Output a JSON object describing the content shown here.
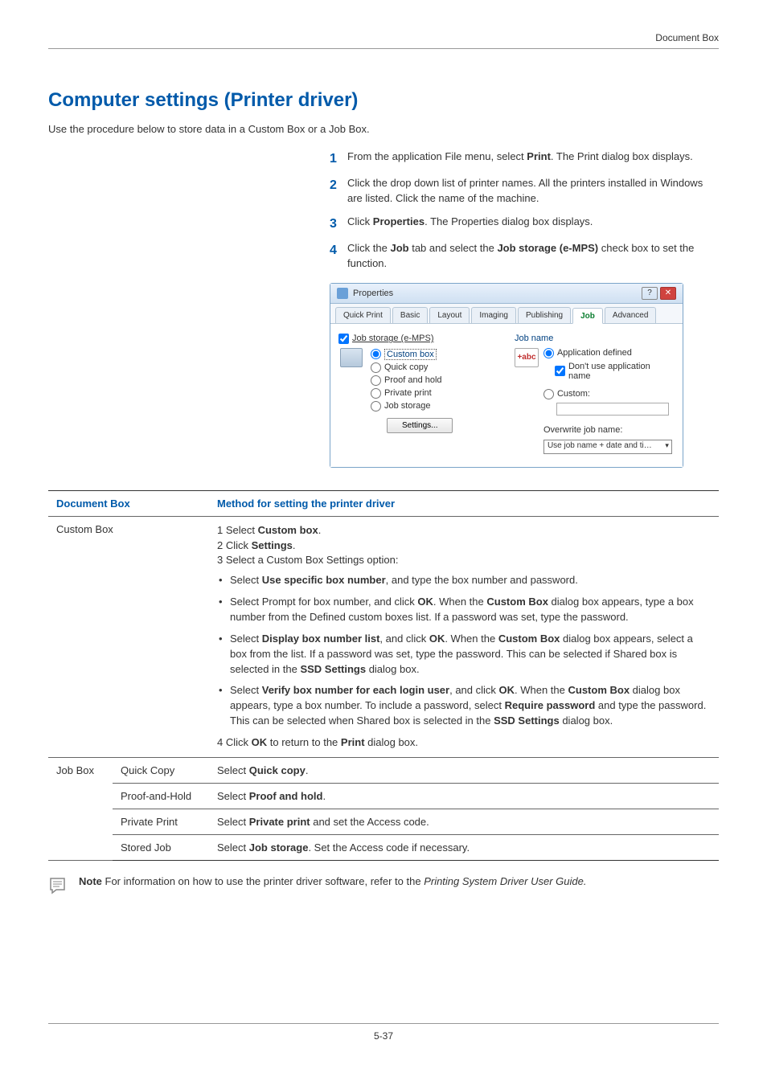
{
  "header": {
    "right": "Document Box"
  },
  "title": "Computer settings (Printer driver)",
  "intro": "Use the procedure below to store data in a Custom Box or a Job Box.",
  "steps": [
    {
      "n": "1",
      "pre": "From the application File menu, select ",
      "b1": "Print",
      "post": ". The Print dialog box displays."
    },
    {
      "n": "2",
      "text": "Click the drop down list of printer names. All the printers installed in Windows are listed. Click the name of the machine."
    },
    {
      "n": "3",
      "pre": "Click ",
      "b1": "Properties",
      "post": ". The Properties dialog box displays."
    },
    {
      "n": "4",
      "pre": "Click the ",
      "b1": "Job",
      "mid": " tab and select the ",
      "b2": "Job storage (e-MPS)",
      "post": " check box to set the function."
    }
  ],
  "win": {
    "title": "Properties",
    "tabs": [
      "Quick Print",
      "Basic",
      "Layout",
      "Imaging",
      "Publishing",
      "Job",
      "Advanced"
    ],
    "job_storage": "Job storage (e-MPS)",
    "radios": [
      "Custom box",
      "Quick copy",
      "Proof and hold",
      "Private print",
      "Job storage"
    ],
    "settings_btn": "Settings...",
    "jobname": "Job name",
    "abc": "+abc",
    "app_defined": "Application defined",
    "dont_use": "Don't use application name",
    "custom": "Custom:",
    "overwrite_lbl": "Overwrite job name:",
    "overwrite_val": "Use job name + date and ti…"
  },
  "table": {
    "h1": "Document Box",
    "h2": "Method for setting the printer driver",
    "custom_box": "Custom Box",
    "cb_line1_a": "1 Select ",
    "cb_line1_b": "Custom box",
    "cb_line1_c": ".",
    "cb_line2_a": "2 Click ",
    "cb_line2_b": "Settings",
    "cb_line2_c": ".",
    "cb_line3": "3 Select a Custom Box Settings option:",
    "cb_bul1_a": "Select ",
    "cb_bul1_b": "Use specific box number",
    "cb_bul1_c": ", and type the box number and password.",
    "cb_bul2_a": "Select Prompt for box number, and click ",
    "cb_bul2_b": "OK",
    "cb_bul2_c": ". When the ",
    "cb_bul2_d": "Custom Box",
    "cb_bul2_e": " dialog box appears, type a box number from the Defined custom boxes list. If a password was set, type the password.",
    "cb_bul3_a": "Select ",
    "cb_bul3_b": "Display box number list",
    "cb_bul3_c": ", and click ",
    "cb_bul3_d": "OK",
    "cb_bul3_e": ". When the ",
    "cb_bul3_f": "Custom Box",
    "cb_bul3_g": " dialog box appears, select a box from the list. If a password was set, type the password. This can be selected if Shared box is selected in the ",
    "cb_bul3_h": "SSD Settings",
    "cb_bul3_i": " dialog box.",
    "cb_bul4_a": "Select ",
    "cb_bul4_b": "Verify box number for each login user",
    "cb_bul4_c": ", and click ",
    "cb_bul4_d": "OK",
    "cb_bul4_e": ". When the ",
    "cb_bul4_f": "Custom Box",
    "cb_bul4_g": " dialog box appears, type a box number. To include a password, select ",
    "cb_bul4_h": "Require password",
    "cb_bul4_i": " and type the password. This can be selected when Shared box is selected in the ",
    "cb_bul4_j": "SSD Settings",
    "cb_bul4_k": " dialog box.",
    "cb_line4_a": "4 Click ",
    "cb_line4_b": "OK",
    "cb_line4_c": " to return to the ",
    "cb_line4_d": "Print",
    "cb_line4_e": " dialog box.",
    "jobbox": "Job Box",
    "row_qc_l": "Quick Copy",
    "row_qc_a": "Select ",
    "row_qc_b": "Quick copy",
    "row_qc_c": ".",
    "row_ph_l": "Proof-and-Hold",
    "row_ph_a": "Select ",
    "row_ph_b": "Proof and hold",
    "row_ph_c": ".",
    "row_pp_l": "Private Print",
    "row_pp_a": "Select ",
    "row_pp_b": "Private print",
    "row_pp_c": " and set the Access code.",
    "row_sj_l": "Stored Job",
    "row_sj_a": "Select ",
    "row_sj_b": "Job storage",
    "row_sj_c": ". Set the Access code if necessary."
  },
  "note": {
    "label": "Note",
    "text": "  For information on how to use the printer driver software, refer to the ",
    "italic": "Printing System Driver User Guide."
  },
  "footer": "5-37"
}
